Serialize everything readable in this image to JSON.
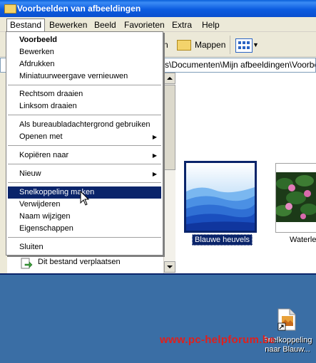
{
  "window": {
    "title": "Voorbeelden van afbeeldingen"
  },
  "menubar": [
    {
      "label": "Bestand"
    },
    {
      "label": "Bewerken"
    },
    {
      "label": "Beeld"
    },
    {
      "label": "Favorieten"
    },
    {
      "label": "Extra"
    },
    {
      "label": "Help"
    }
  ],
  "toolbar": {
    "view_label": "n",
    "folders_label": "Mappen",
    "views_icon": "views-icon"
  },
  "address": {
    "value": "rs\\Documenten\\Mijn afbeeldingen\\Voorbeelden"
  },
  "dropdown": {
    "items": [
      {
        "label": "Voorbeeld",
        "bold": true
      },
      {
        "label": "Bewerken"
      },
      {
        "label": "Afdrukken"
      },
      {
        "label": "Miniatuurweergave vernieuwen"
      },
      {
        "label": "Rechtsom draaien"
      },
      {
        "label": "Linksom draaien"
      },
      {
        "label": "Als bureaubladachtergrond gebruiken"
      },
      {
        "label": "Openen met",
        "submenu": true
      },
      {
        "label": "Kopiëren naar",
        "submenu": true
      },
      {
        "label": "Nieuw",
        "submenu": true
      },
      {
        "label": "Snelkoppeling maken",
        "highlighted": true
      },
      {
        "label": "Verwijderen"
      },
      {
        "label": "Naam wijzigen"
      },
      {
        "label": "Eigenschappen"
      },
      {
        "label": "Sluiten"
      }
    ]
  },
  "taskpane": {
    "move_label": "Dit bestand verplaatsen"
  },
  "files": [
    {
      "name": "Blauwe heuvels",
      "selected": true
    },
    {
      "name": "Waterle"
    }
  ],
  "desktop": {
    "icon_caption_line1": "Snelkoppeling",
    "icon_caption_line2": "naar Blauw...",
    "watermark": "www.pc-helpforum.be"
  },
  "colors": {
    "titlebar": "#0a5fd9",
    "highlight": "#0a246a",
    "desktop": "#3a6ea5",
    "watermark": "#e0201c"
  }
}
